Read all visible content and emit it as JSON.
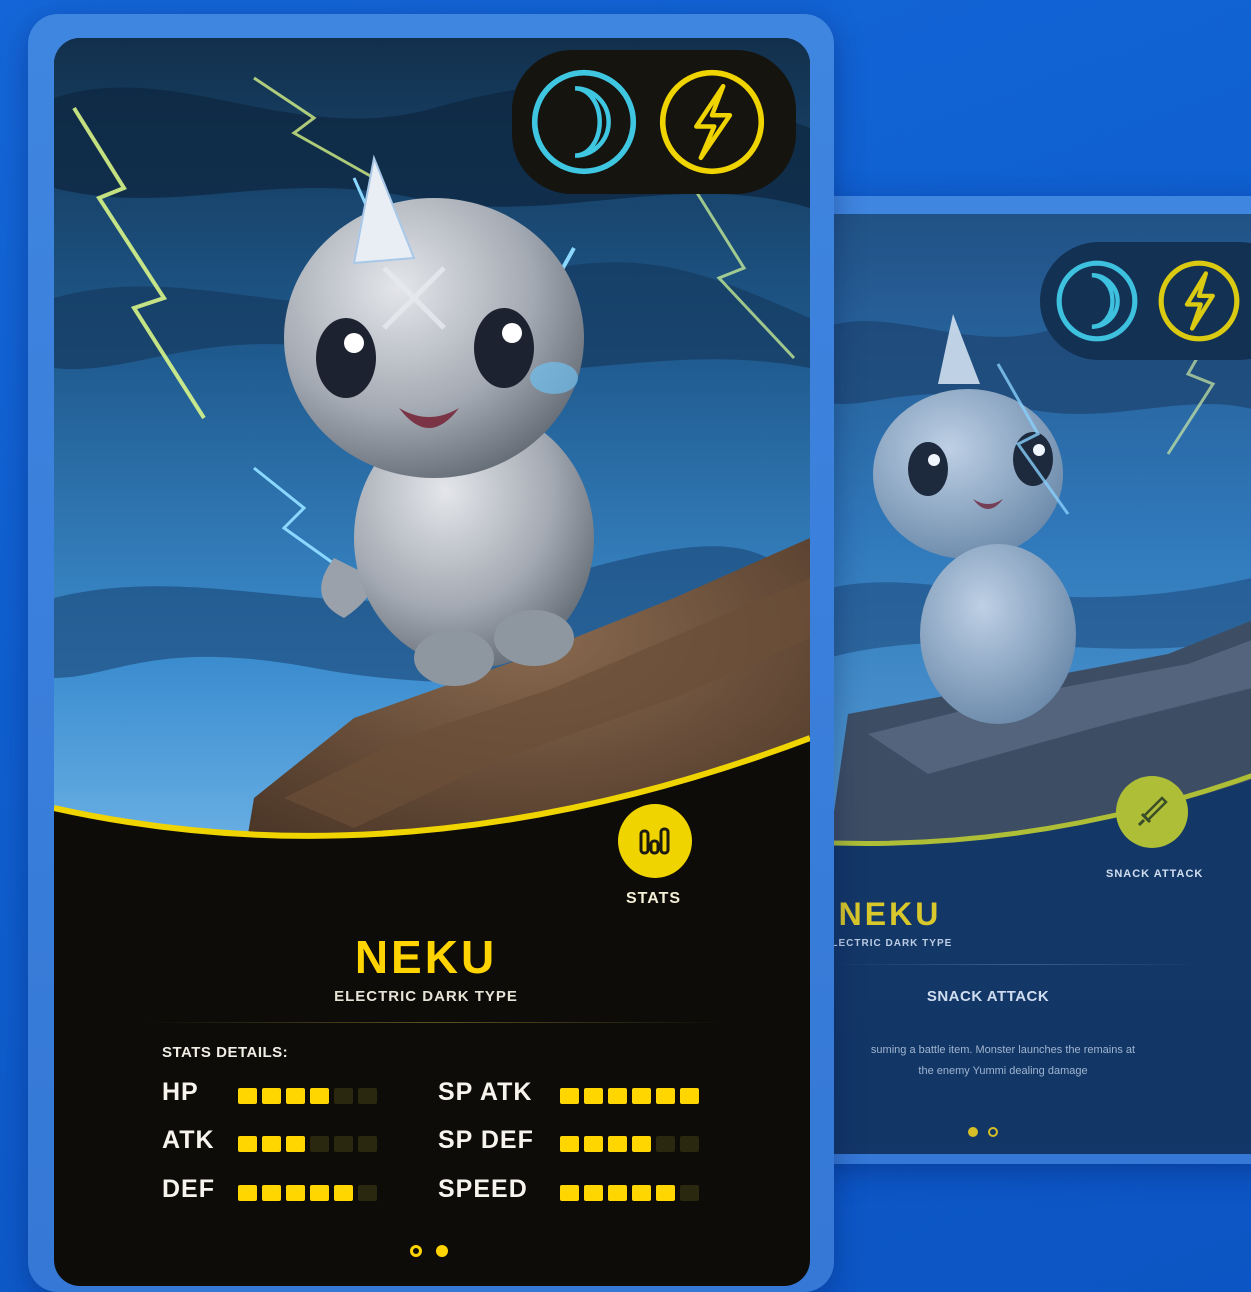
{
  "front_card": {
    "types": [
      "dark-moon-icon",
      "electric-bolt-icon"
    ],
    "tab_label": "STATS",
    "tab_icon": "bar-chart-icon",
    "name": "NEKU",
    "type_text": "ELECTRIC DARK TYPE",
    "stats_heading": "STATS DETAILS:",
    "stats": [
      {
        "label": "HP",
        "value": 4,
        "max": 6
      },
      {
        "label": "ATK",
        "value": 3,
        "max": 6
      },
      {
        "label": "DEF",
        "value": 5,
        "max": 6
      },
      {
        "label": "SP ATK",
        "value": 6,
        "max": 6
      },
      {
        "label": "SP DEF",
        "value": 4,
        "max": 6
      },
      {
        "label": "SPEED",
        "value": 5,
        "max": 6
      }
    ],
    "page_dots": {
      "count": 2,
      "active": 2
    }
  },
  "back_card": {
    "types": [
      "dark-moon-icon",
      "electric-bolt-icon"
    ],
    "tab_label": "SNACK ATTACK",
    "tab_icon": "sword-icon",
    "name": "NEKU",
    "type_text": "ELECTRIC DARK TYPE",
    "attack_title": "SNACK ATTACK",
    "description_line1": "suming a battle item. Monster launches the remains at",
    "description_line2": "the enemy Yummi dealing damage",
    "page_dots": {
      "count": 2,
      "active": 1
    }
  },
  "colors": {
    "accent_yellow": "#ffd400",
    "dark_type_cyan": "#3fc6e0",
    "background_blue": "#1466d8"
  }
}
